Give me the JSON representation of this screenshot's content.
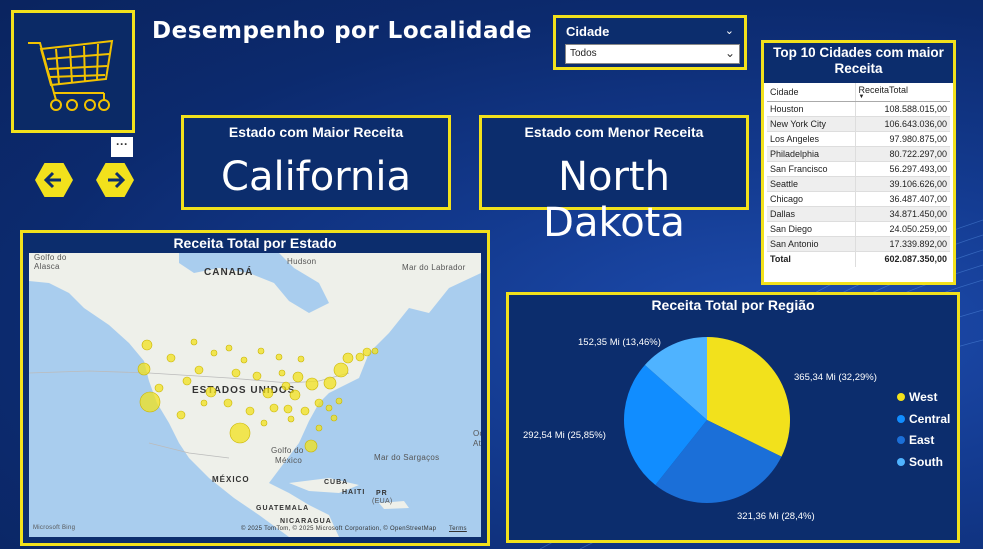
{
  "page": {
    "title": "Desempenho por Localidade"
  },
  "slicer": {
    "title": "Cidade",
    "value": "Todos"
  },
  "cards": {
    "max": {
      "title": "Estado com Maior Receita",
      "value": "California"
    },
    "min": {
      "title": "Estado com Menor Receita",
      "value": "North Dakota"
    }
  },
  "top10": {
    "title": "Top 10 Cidades com maior Receita",
    "columns": [
      "Cidade",
      "ReceitaTotal"
    ],
    "rows": [
      [
        "Houston",
        "108.588.015,00"
      ],
      [
        "New York City",
        "106.643.036,00"
      ],
      [
        "Los Angeles",
        "97.980.875,00"
      ],
      [
        "Philadelphia",
        "80.722.297,00"
      ],
      [
        "San Francisco",
        "56.297.493,00"
      ],
      [
        "Seattle",
        "39.106.626,00"
      ],
      [
        "Chicago",
        "36.487.407,00"
      ],
      [
        "Dallas",
        "34.871.450,00"
      ],
      [
        "San Diego",
        "24.050.259,00"
      ],
      [
        "San Antonio",
        "17.339.892,00"
      ]
    ],
    "total_label": "Total",
    "total_value": "602.087.350,00"
  },
  "map": {
    "title": "Receita Total por Estado",
    "labels": {
      "canada": "CANADÁ",
      "usa": "ESTADOS UNIDOS",
      "mexico_country": "MÉXICO",
      "hudson": "Hudson",
      "golfo_alasca": "Golfo do",
      "alasca": "Alasca",
      "labrador": "Mar do Labrador",
      "golfo_mexico": "Golfo do",
      "mexico_sea": "México",
      "sargacos": "Mar do Sargaços",
      "cuba": "CUBA",
      "haiti": "HAITI",
      "pr": "PR",
      "eua": "(EUA)",
      "guatemala": "GUATEMALA",
      "nicaragua": "NICARAGUA",
      "oc": "Oc",
      "atl": "Atl"
    },
    "bing": "Microsoft Bing",
    "attribution": "© 2025 TomTom, © 2025 Microsoft Corporation, © OpenStreetMap",
    "terms": "Terms",
    "bubble_color": "#f2e11c"
  },
  "chart_data": {
    "type": "pie",
    "title": "Receita Total por Região",
    "categories": [
      "West",
      "East",
      "Central",
      "South"
    ],
    "values": [
      365.34,
      321.36,
      292.54,
      152.35
    ],
    "labels": [
      "365,34 Mi (32,29%)",
      "321,36 Mi (28,4%)",
      "292,54 Mi (25,85%)",
      "152,35 Mi (13,46%)"
    ],
    "colors": [
      "#f2e11c",
      "#1b6fd8",
      "#118dff",
      "#4fb3ff"
    ],
    "legend": {
      "position": "right",
      "items": [
        "West",
        "Central",
        "East",
        "South"
      ],
      "colors": [
        "#f2e11c",
        "#118dff",
        "#1b6fd8",
        "#4fb3ff"
      ]
    }
  }
}
